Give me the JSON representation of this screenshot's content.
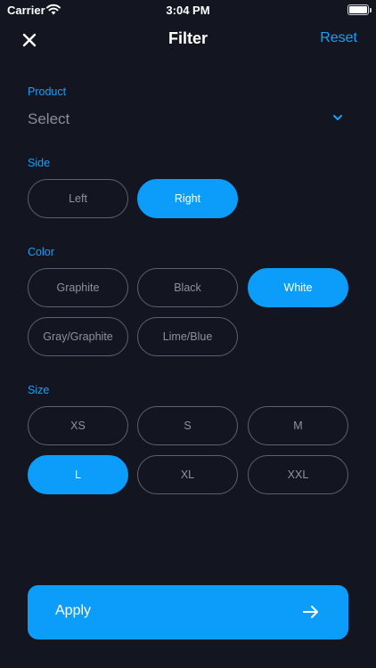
{
  "status_bar": {
    "carrier": "Carrier",
    "time": "3:04 PM"
  },
  "nav": {
    "title": "Filter",
    "reset_label": "Reset",
    "close_icon": "close-icon"
  },
  "product": {
    "label": "Product",
    "value": "Select"
  },
  "side": {
    "label": "Side",
    "options": [
      "Left",
      "Right"
    ],
    "selected": "Right"
  },
  "color": {
    "label": "Color",
    "options": [
      "Graphite",
      "Black",
      "White",
      "Gray/Graphite",
      "Lime/Blue"
    ],
    "selected": "White"
  },
  "size": {
    "label": "Size",
    "options": [
      "XS",
      "S",
      "M",
      "L",
      "XL",
      "XXL"
    ],
    "selected": "L"
  },
  "apply": {
    "label": "Apply"
  },
  "theme": {
    "accent": "#0c9cfa",
    "background": "#131620",
    "chip_border": "#5c6070"
  }
}
